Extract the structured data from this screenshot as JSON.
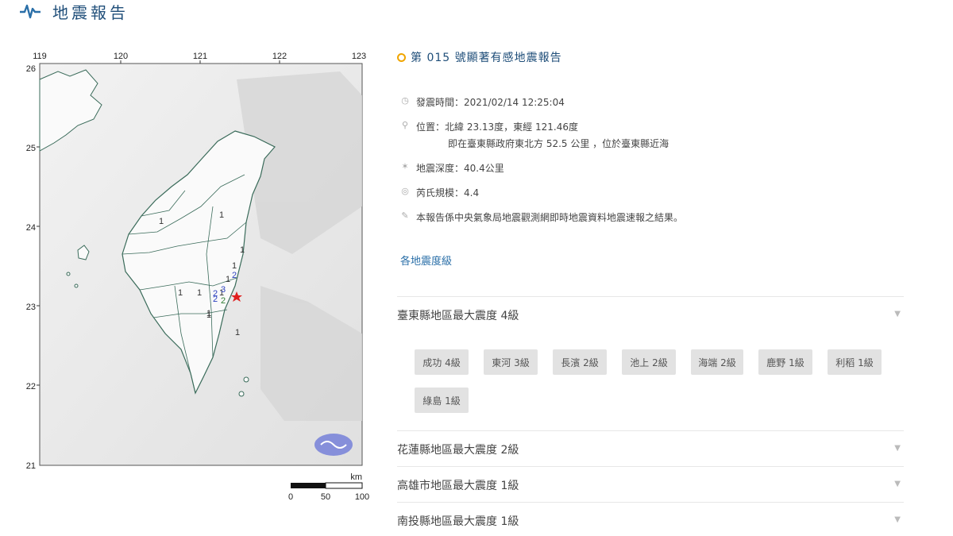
{
  "header": {
    "title": "地震報告",
    "icon": "seismograph-wave-icon"
  },
  "map": {
    "lon_ticks": [
      "119",
      "120",
      "121",
      "122",
      "123"
    ],
    "lat_ticks": [
      "26",
      "25",
      "24",
      "23",
      "22",
      "21"
    ],
    "scale_unit": "km",
    "scale_ticks": [
      "0",
      "50",
      "100"
    ],
    "epicenter_color": "#e0201f",
    "intensity_labels": [
      "1",
      "1",
      "1",
      "1",
      "1",
      "1",
      "1",
      "1",
      "1",
      "1",
      "2",
      "2",
      "2",
      "2",
      "3",
      "1"
    ]
  },
  "report": {
    "title": "第 015 號顯著有感地震報告",
    "time_label": "發震時間：2021/02/14 12:25:04",
    "location_label": "位置：北緯 23.13度，東經 121.46度",
    "location_detail": "即在臺東縣政府東北方 52.5 公里 ，位於臺東縣近海",
    "depth_label": "地震深度：40.4公里",
    "magnitude_label": "芮氏規模：4.4",
    "note": "本報告係中央氣象局地震觀測網即時地震資料地震速報之結果。",
    "section_label": "各地震度級"
  },
  "counties": [
    {
      "label": "臺東縣地區最大震度 4級"
    },
    {
      "label": "花蓮縣地區最大震度 2級"
    },
    {
      "label": "高雄市地區最大震度 1級"
    },
    {
      "label": "南投縣地區最大震度 1級"
    }
  ],
  "stations": [
    {
      "label": "成功 4級"
    },
    {
      "label": "東河 3級"
    },
    {
      "label": "長濱 2級"
    },
    {
      "label": "池上 2級"
    },
    {
      "label": "海端 2級"
    },
    {
      "label": "鹿野 1級"
    },
    {
      "label": "利稻 1級"
    },
    {
      "label": "綠島 1級"
    }
  ]
}
